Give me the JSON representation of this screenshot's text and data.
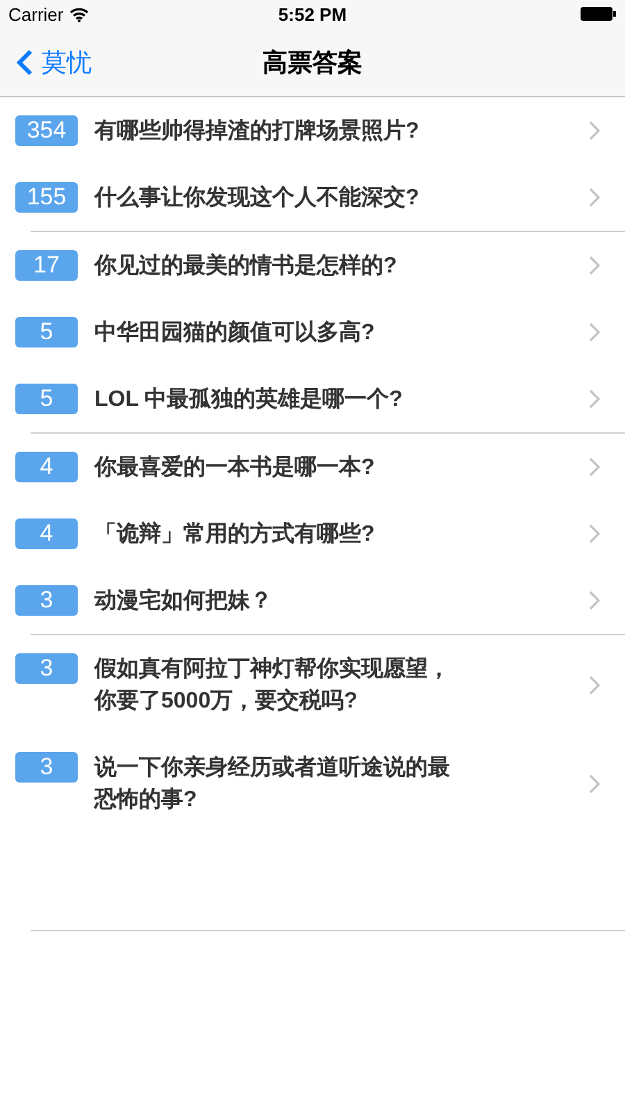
{
  "status_bar": {
    "carrier": "Carrier",
    "time": "5:52 PM"
  },
  "nav_bar": {
    "back_label": "莫忧",
    "title": "高票答案"
  },
  "sections": [
    {
      "rows": [
        {
          "count": "354",
          "question": "有哪些帅得掉渣的打牌场景照片?"
        },
        {
          "count": "155",
          "question": "什么事让你发现这个人不能深交?"
        }
      ]
    },
    {
      "rows": [
        {
          "count": "17",
          "question": "你见过的最美的情书是怎样的?"
        },
        {
          "count": "5",
          "question": "中华田园猫的颜值可以多高?"
        },
        {
          "count": "5",
          "question": "LOL 中最孤独的英雄是哪一个?"
        }
      ]
    },
    {
      "rows": [
        {
          "count": "4",
          "question": "你最喜爱的一本书是哪一本?"
        },
        {
          "count": "4",
          "question": "「诡辩」常用的方式有哪些?"
        },
        {
          "count": "3",
          "question": "动漫宅如何把妹？"
        }
      ]
    },
    {
      "rows": [
        {
          "count": "3",
          "question": "假如真有阿拉丁神灯帮你实现愿望，你要了5000万，要交税吗?"
        },
        {
          "count": "3",
          "question": "说一下你亲身经历或者道听途说的最恐怖的事?"
        }
      ]
    }
  ]
}
